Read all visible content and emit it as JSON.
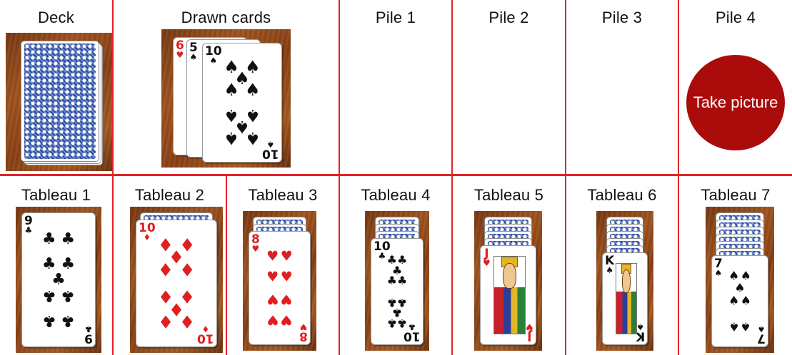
{
  "top_row": {
    "deck": {
      "label": "Deck"
    },
    "drawn": {
      "label": "Drawn cards",
      "cards": [
        {
          "rank": "6",
          "suit": "♥",
          "color": "red"
        },
        {
          "rank": "5",
          "suit": "♠",
          "color": "black"
        },
        {
          "rank": "10",
          "suit": "♠",
          "color": "black"
        }
      ]
    },
    "piles": [
      {
        "label": "Pile 1"
      },
      {
        "label": "Pile 2"
      },
      {
        "label": "Pile 3"
      },
      {
        "label": "Pile 4"
      }
    ],
    "take_picture_label": "Take picture"
  },
  "tableaus": [
    {
      "label": "Tableau 1",
      "face_down": 0,
      "top": {
        "rank": "9",
        "suit": "♣",
        "color": "black"
      }
    },
    {
      "label": "Tableau 2",
      "face_down": 1,
      "top": {
        "rank": "10",
        "suit": "♦",
        "color": "red"
      }
    },
    {
      "label": "Tableau 3",
      "face_down": 2,
      "top": {
        "rank": "8",
        "suit": "♥",
        "color": "red"
      }
    },
    {
      "label": "Tableau 4",
      "face_down": 3,
      "top": {
        "rank": "10",
        "suit": "♣",
        "color": "black"
      }
    },
    {
      "label": "Tableau 5",
      "face_down": 4,
      "top": {
        "rank": "J",
        "suit": "♥",
        "color": "red"
      }
    },
    {
      "label": "Tableau 6",
      "face_down": 5,
      "top": {
        "rank": "K",
        "suit": "♠",
        "color": "black"
      }
    },
    {
      "label": "Tableau 7",
      "face_down": 6,
      "top": {
        "rank": "7",
        "suit": "♠",
        "color": "black"
      }
    }
  ],
  "colors": {
    "grid_line": "#e0242a",
    "button": "#aa0b0b",
    "card_back": "#2d4c9a"
  }
}
